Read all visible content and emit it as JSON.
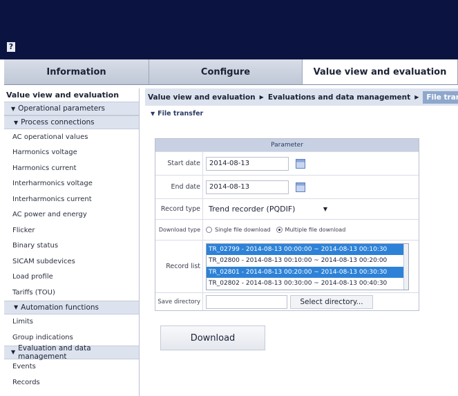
{
  "help_icon": "?",
  "tabs": [
    {
      "label": "Information"
    },
    {
      "label": "Configure"
    },
    {
      "label": "Value view and evaluation"
    }
  ],
  "sidebar": {
    "title": "Value view and evaluation",
    "groups": {
      "operational": "Operational parameters",
      "process": "Process connections",
      "automation": "Automation functions",
      "evaluation": "Evaluation and data management"
    },
    "process_items": [
      "AC operational values",
      "Harmonics voltage",
      "Harmonics current",
      "Interharmonics voltage",
      "Interharmonics current",
      "AC power and energy",
      "Flicker",
      "Binary status",
      "SICAM subdevices",
      "Load profile",
      "Tariffs (TOU)"
    ],
    "automation_items": [
      "Limits",
      "Group indications"
    ],
    "evaluation_items": [
      "Events",
      "Records"
    ]
  },
  "breadcrumb": {
    "part1": "Value view and evaluation",
    "part2": "Evaluations and data management",
    "current": "File transfer"
  },
  "section_title": "File transfer",
  "panel": {
    "header": "Parameter",
    "start_label": "Start date",
    "start_value": "2014-08-13",
    "end_label": "End date",
    "end_value": "2014-08-13",
    "record_type_label": "Record type",
    "record_type_value": "Trend recorder (PQDIF)",
    "download_type_label": "Download type",
    "single_label": "Single file download",
    "multiple_label": "Multiple file download",
    "record_list_label": "Record list",
    "records": [
      "TR_02799 - 2014-08-13 00:00:00 ~ 2014-08-13 00:10:30",
      "TR_02800 - 2014-08-13 00:10:00 ~ 2014-08-13 00:20:00",
      "TR_02801 - 2014-08-13 00:20:00 ~ 2014-08-13 00:30:30",
      "TR_02802 - 2014-08-13 00:30:00 ~ 2014-08-13 00:40:30"
    ],
    "save_dir_label": "Save directory",
    "select_dir_label": "Select directory..."
  },
  "download_label": "Download",
  "colors": {
    "topbar": "#0b1440",
    "selection": "#2d82d7",
    "panel_header": "#c7d1e3"
  }
}
